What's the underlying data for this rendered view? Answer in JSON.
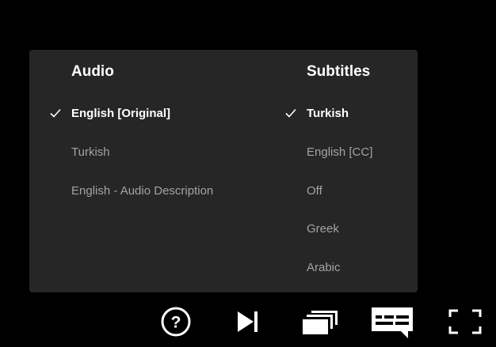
{
  "panel": {
    "audio": {
      "title": "Audio",
      "options": [
        {
          "label": "English [Original]",
          "selected": true
        },
        {
          "label": "Turkish",
          "selected": false
        },
        {
          "label": "English - Audio Description",
          "selected": false
        }
      ]
    },
    "subtitles": {
      "title": "Subtitles",
      "options": [
        {
          "label": "Turkish",
          "selected": true
        },
        {
          "label": "English [CC]",
          "selected": false
        },
        {
          "label": "Off",
          "selected": false
        },
        {
          "label": "Greek",
          "selected": false
        },
        {
          "label": "Arabic",
          "selected": false
        }
      ]
    }
  },
  "controls": {
    "icons": [
      "help-icon",
      "next-episode-icon",
      "episodes-icon",
      "audio-subtitles-icon",
      "fullscreen-icon"
    ]
  },
  "colors": {
    "panel_bg": "#262626",
    "selected_text": "#ffffff",
    "unselected_text": "#a3a3a3"
  }
}
